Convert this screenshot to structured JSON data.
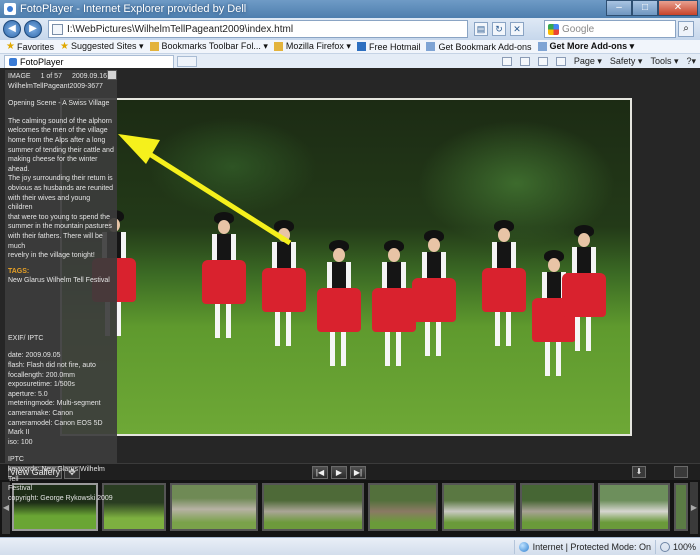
{
  "window": {
    "title": "FotoPlayer - Internet Explorer provided by Dell",
    "min_label": "–",
    "max_label": "□",
    "close_label": "✕"
  },
  "addressbar": {
    "url": "I:\\WebPictures\\WilhelmTellPageant2009\\index.html",
    "search_placeholder": "Google"
  },
  "favorites": {
    "favorites_label": "Favorites",
    "items": [
      "Suggested Sites ▾",
      "Bookmarks Toolbar Fol... ▾",
      "Mozilla Firefox ▾",
      "Free Hotmail",
      "Get Bookmark Add-ons",
      "Get More Add-ons ▾"
    ]
  },
  "tabs": {
    "active_tab": "FotoPlayer"
  },
  "commandbar": {
    "page": "Page ▾",
    "safety": "Safety ▾",
    "tools": "Tools ▾",
    "help": "?▾"
  },
  "info": {
    "image_label": "IMAGE",
    "counter": "1 of 57",
    "date": "2009.09.16",
    "filename": "WilhelmTellPageant2009-3677",
    "caption_title": "Opening Scene - A Swiss Village",
    "description": [
      "The calming sound of the alphorn",
      "welcomes the men of the village",
      "home from the Alps after a long",
      "summer of tending their cattle and",
      "making cheese for the winter ahead.",
      "The joy surrounding their return is",
      "obvious as husbands are reunited",
      "with their wives and young children",
      "that were too young to spend the",
      "summer in the mountain pastures",
      "with their fathers. There will be much",
      "revelry in the village tonight!"
    ],
    "tags_label": "TAGS:",
    "tags": "New Glarus Wilhelm Tell Festival",
    "exif_label": "EXIF/ IPTC",
    "exif": [
      "date: 2009.09.05",
      "flash: Flash did not fire, auto",
      "focallength: 200.0mm",
      "exposuretime: 1/500s",
      "aperture: 5.0",
      "meteringmode: Multi-segment",
      "cameramake: Canon",
      "cameramodel: Canon EOS 5D Mark II",
      "iso: 100"
    ],
    "iptc_label": "IPTC",
    "iptc": [
      "keywords: New Glarus Wilhelm Tell",
      "Festival",
      "copyright: George Rykowski 2009"
    ]
  },
  "controls": {
    "view_gallery": "View Gallery",
    "move_icon": "✥",
    "prev_icon": "|◀",
    "play_icon": "▶",
    "next_icon": "▶|",
    "download_icon": "⬇"
  },
  "statusbar": {
    "zone": "Internet | Protected Mode: On",
    "zoom": "100%"
  },
  "colors": {
    "arrow": "#f5f01c",
    "tags_accent": "#e7a126"
  }
}
